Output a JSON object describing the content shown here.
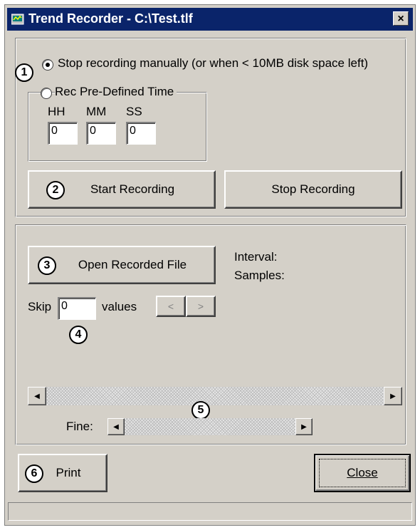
{
  "window": {
    "title": "Trend Recorder - C:\\Test.tlf",
    "close_glyph": "×"
  },
  "recording": {
    "option_manual": "Stop recording manually (or when < 10MB disk space left)",
    "option_predefined": "Rec Pre-Defined Time",
    "selected_option": "manual",
    "hh_label": "HH",
    "mm_label": "MM",
    "ss_label": "SS",
    "hh_value": "0",
    "mm_value": "0",
    "ss_value": "0",
    "start_button": "Start Recording",
    "stop_button": "Stop Recording"
  },
  "playback": {
    "open_button": "Open Recorded File",
    "interval_label": "Interval:",
    "samples_label": "Samples:",
    "skip_label": "Skip",
    "skip_value": "0",
    "values_label": "values",
    "prev_glyph": "<",
    "next_glyph": ">",
    "fine_label": "Fine:",
    "left_arrow": "◀",
    "right_arrow": "▶"
  },
  "footer": {
    "print_button": "Print",
    "close_button": "Close"
  },
  "markers": {
    "m1": "1",
    "m2": "2",
    "m3": "3",
    "m4": "4",
    "m5": "5",
    "m6": "6"
  },
  "colors": {
    "titlebar": "#0a246a",
    "face": "#d4d0c8"
  }
}
